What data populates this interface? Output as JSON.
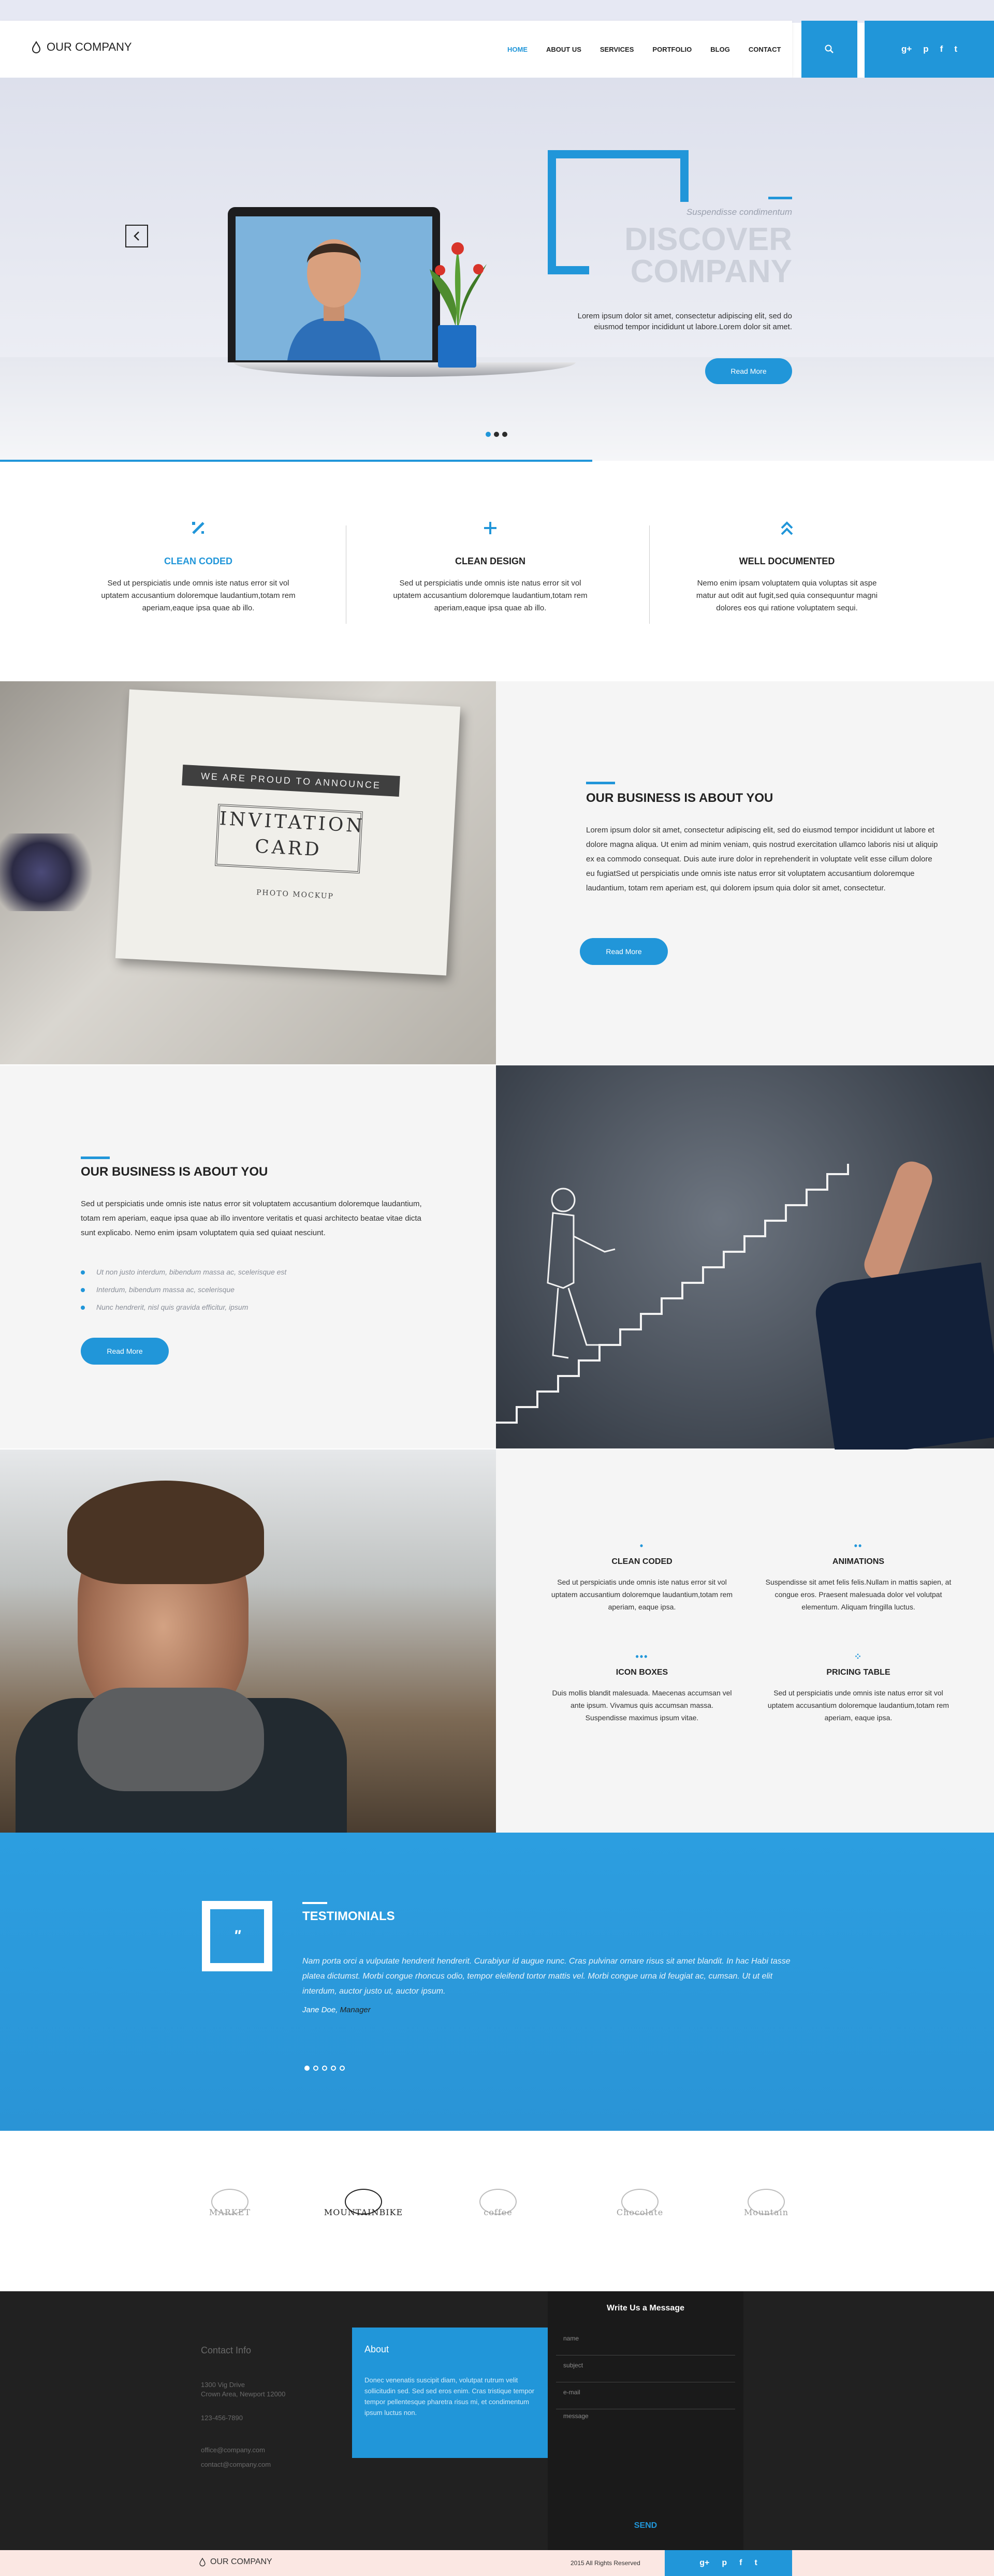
{
  "brand": {
    "name": "OUR COMPANY",
    "accent": "#2196d9"
  },
  "nav": {
    "items": [
      "HOME",
      "ABOUT US",
      "SERVICES",
      "PORTFOLIO",
      "BLOG",
      "CONTACT"
    ],
    "active": "HOME"
  },
  "header": {
    "search_icon": "search-icon",
    "social": [
      "g+",
      "p",
      "f",
      "t"
    ]
  },
  "hero": {
    "subtitle": "Suspendisse condimentum",
    "title_line1": "DISCOVER",
    "title_line2": "COMPANY",
    "text": "Lorem ipsum dolor sit amet, consectetur adipiscing elit, sed do eiusmod tempor incididunt ut labore.Lorem dolor sit amet.",
    "button": "Read More"
  },
  "features": [
    {
      "title": "CLEAN CODED",
      "text": "Sed ut perspiciatis unde omnis iste natus error sit vol uptatem accusantium doloremque laudantium,totam rem aperiam,eaque ipsa quae ab illo."
    },
    {
      "title": "CLEAN DESIGN",
      "text": "Sed ut perspiciatis unde omnis iste natus error sit vol uptatem accusantium doloremque laudantium,totam rem aperiam,eaque ipsa quae ab illo."
    },
    {
      "title": "WELL DOCUMENTED",
      "text": "Nemo enim ipsam voluptatem quia voluptas sit aspe matur aut odit aut fugit,sed quia consequuntur magni dolores eos qui ratione voluptatem sequi."
    }
  ],
  "card": {
    "banner": "WE ARE PROUD TO ANNOUNCE",
    "line1": "INVITATION",
    "line2": "CARD",
    "foot": "PHOTO MOCKUP"
  },
  "about1": {
    "title": "OUR BUSINESS IS ABOUT YOU",
    "text": "Lorem ipsum dolor sit amet, consectetur adipiscing elit, sed do eiusmod tempor incididunt ut labore et dolore magna aliqua. Ut enim ad minim veniam, quis nostrud exercitation ullamco laboris nisi ut aliquip ex ea commodo consequat. Duis aute irure dolor in reprehenderit in voluptate velit esse cillum dolore eu fugiatSed ut perspiciatis unde omnis iste natus error sit voluptatem accusantium doloremque laudantium, totam rem aperiam est, qui dolorem ipsum quia dolor sit amet, consectetur.",
    "button": "Read More"
  },
  "about2": {
    "title": "OUR BUSINESS IS ABOUT YOU",
    "text": "Sed ut perspiciatis unde omnis iste natus error sit voluptatem accusantium doloremque laudantium, totam rem aperiam, eaque ipsa quae ab illo inventore veritatis et quasi architecto beatae vitae dicta sunt explicabo. Nemo enim ipsam voluptatem quia sed quiaat nesciunt.",
    "bullets": [
      "Ut non justo interdum, bibendum massa ac, scelerisque est",
      "Interdum, bibendum massa ac, scelerisque",
      "Nunc hendrerit, nisl quis gravida efficitur, ipsum"
    ],
    "button": "Read More"
  },
  "services": [
    {
      "icon": "•",
      "title": "CLEAN CODED",
      "text": "Sed ut perspiciatis unde omnis iste natus error sit vol uptatem accusantium doloremque laudantium,totam rem aperiam, eaque ipsa."
    },
    {
      "icon": "••",
      "title": "ANIMATIONS",
      "text": "Suspendisse sit amet felis felis.Nullam in mattis sapien, at congue eros. Praesent malesuada dolor vel volutpat elementum. Aliquam fringilla luctus."
    },
    {
      "icon": "•••",
      "title": "ICON BOXES",
      "text": "Duis mollis blandit malesuada. Maecenas accumsan vel ante ipsum. Vivamus quis accumsan massa. Suspendisse maximus ipsum vitae."
    },
    {
      "icon": "⁘",
      "title": "PRICING TABLE",
      "text": "Sed ut perspiciatis unde omnis iste natus error sit vol uptatem accusantium doloremque laudantium,totam rem aperiam, eaque ipsa."
    }
  ],
  "testimonials": {
    "title": "TESTIMONIALS",
    "quote_mark": "\"",
    "text": "Nam porta orci a vulputate hendrerit hendrerit. Curabiyur id augue nunc. Cras pulvinar ornare risus sit amet blandit. In hac Habi tasse platea dictumst. Morbi congue rhoncus odio, tempor eleifend tortor mattis vel. Morbi congue urna id feugiat ac, cumsan. Ut ut elit interdum, auctor justo ut, auctor ipsum.",
    "author": "Jane Doe,",
    "role": "Manager"
  },
  "clients": [
    "MARKET",
    "MOUNTAINBIKE",
    "coffee",
    "Chocolate",
    "Mountain"
  ],
  "footer": {
    "contact_title": "Contact Info",
    "address1": "1300 Vig Drive",
    "address2": "Crown Area, Newport 12000",
    "phone": "123-456-7890",
    "email1": "office@company.com",
    "email2": "contact@company.com",
    "about_title": "About",
    "about_text": "Donec venenatis suscipit diam, volutpat rutrum velit sollicitudin sed. Sed sed eros enim. Cras tristique tempor tempor pellentesque pharetra risus mi, et condimentum ipsum luctus non.",
    "form_title": "Write Us a Message",
    "fields": [
      "name",
      "subject",
      "e-mail"
    ],
    "message": "message",
    "send": "SEND"
  },
  "bottom": {
    "name": "OUR COMPANY",
    "copyright": "2015 All Rights Reserved",
    "social": [
      "g+",
      "p",
      "f",
      "t"
    ]
  }
}
